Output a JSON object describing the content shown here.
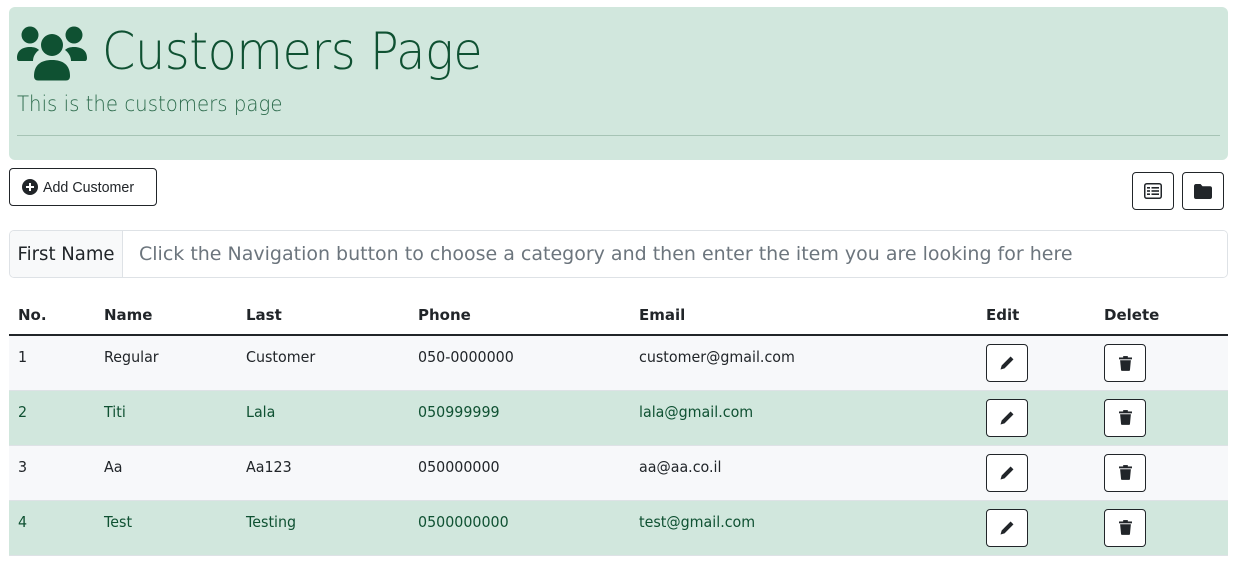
{
  "header": {
    "icon": "users-icon",
    "title": "Customers Page",
    "subtitle": "This is the customers page"
  },
  "toolbar": {
    "add_label": "Add Customer",
    "add_icon": "plus-circle-icon",
    "view_buttons": [
      "list-view-icon",
      "folder-icon"
    ]
  },
  "search": {
    "category_label": "First Name",
    "placeholder": "Click the Navigation button to choose a category and then enter the item you are looking for here",
    "value": ""
  },
  "table": {
    "columns": [
      "No.",
      "Name",
      "Last",
      "Phone",
      "Email",
      "Edit",
      "Delete"
    ],
    "rows": [
      {
        "no": "1",
        "name": "Regular",
        "last": "Customer",
        "phone": "050-0000000",
        "email": "customer@gmail.com"
      },
      {
        "no": "2",
        "name": "Titi",
        "last": "Lala",
        "phone": "050999999",
        "email": "lala@gmail.com"
      },
      {
        "no": "3",
        "name": "Aa",
        "last": "Aa123",
        "phone": "050000000",
        "email": "aa@aa.co.il"
      },
      {
        "no": "4",
        "name": "Test",
        "last": "Testing",
        "phone": "0500000000",
        "email": "test@gmail.com"
      }
    ]
  },
  "colors": {
    "hero_bg": "#d1e7dd",
    "hero_text": "#0f5132",
    "row_alt_bg": "#d1e7dd",
    "row_bg": "#f7f8fa"
  }
}
